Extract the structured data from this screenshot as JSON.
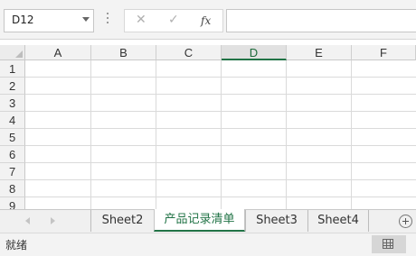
{
  "name_box": {
    "value": "D12"
  },
  "formula_bar": {
    "cancel_glyph": "✕",
    "enter_glyph": "✓",
    "fx_label": "fx",
    "content": ""
  },
  "columns": [
    "A",
    "B",
    "C",
    "D",
    "E",
    "F"
  ],
  "selected_column": "D",
  "rows": [
    "1",
    "2",
    "3",
    "4",
    "5",
    "6",
    "7",
    "8",
    "9"
  ],
  "sheet_tabs": [
    {
      "label": "Sheet2",
      "active": false
    },
    {
      "label": "产品记录清单",
      "active": true
    },
    {
      "label": "Sheet3",
      "active": false
    },
    {
      "label": "Sheet4",
      "active": false
    }
  ],
  "status_bar": {
    "ready_text": "就绪"
  },
  "colors": {
    "accent": "#217346"
  }
}
